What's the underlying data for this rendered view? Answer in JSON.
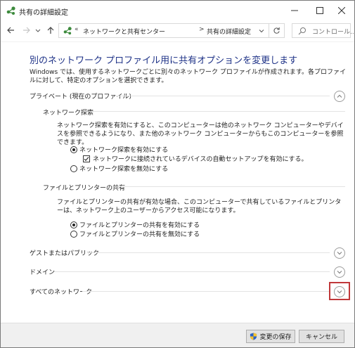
{
  "window": {
    "title": "共有の詳細設定"
  },
  "address": {
    "chevrons": "«",
    "crumb1": "ネットワークと共有センター",
    "separator": ">",
    "crumb2": "共有の詳細設定"
  },
  "search": {
    "placeholder": "コントロール..."
  },
  "page": {
    "heading": "別のネットワーク プロファイル用に共有オプションを変更します",
    "intro": "Windows では、使用するネットワークごとに別々のネットワーク プロファイルが作成されます。各プロファイルに対して、特定のオプションを選択できます。"
  },
  "private": {
    "label": "プライベート (現在のプロファイル)",
    "discovery": {
      "title": "ネットワーク探索",
      "description": "ネットワーク探索を有効にすると、このコンピューターは他のネットワーク コンピューターやデバイスを参照できるようになり、また他のネットワーク コンピューターからもこのコンピューターを参照できます。",
      "on_label": "ネットワーク探索を有効にする",
      "auto_setup_label": "ネットワークに接続されているデバイスの自動セットアップを有効にする。",
      "off_label": "ネットワーク探索を無効にする"
    },
    "sharing": {
      "title": "ファイルとプリンターの共有",
      "description": "ファイルとプリンターの共有が有効な場合、このコンピューターで共有しているファイルとプリンターは、ネットワーク上のユーザーからアクセス可能になります。",
      "on_label": "ファイルとプリンターの共有を有効にする",
      "off_label": "ファイルとプリンターの共有を無効にする"
    }
  },
  "guest": {
    "label": "ゲストまたはパブリック"
  },
  "domain": {
    "label": "ドメイン"
  },
  "all": {
    "label": "すべてのネットワーク"
  },
  "footer": {
    "save_label": "変更の保存",
    "cancel_label": "キャンセル"
  },
  "colors": {
    "heading": "#1e3287",
    "focus": "#c0383a",
    "footer_bg": "#f0f0f0"
  }
}
